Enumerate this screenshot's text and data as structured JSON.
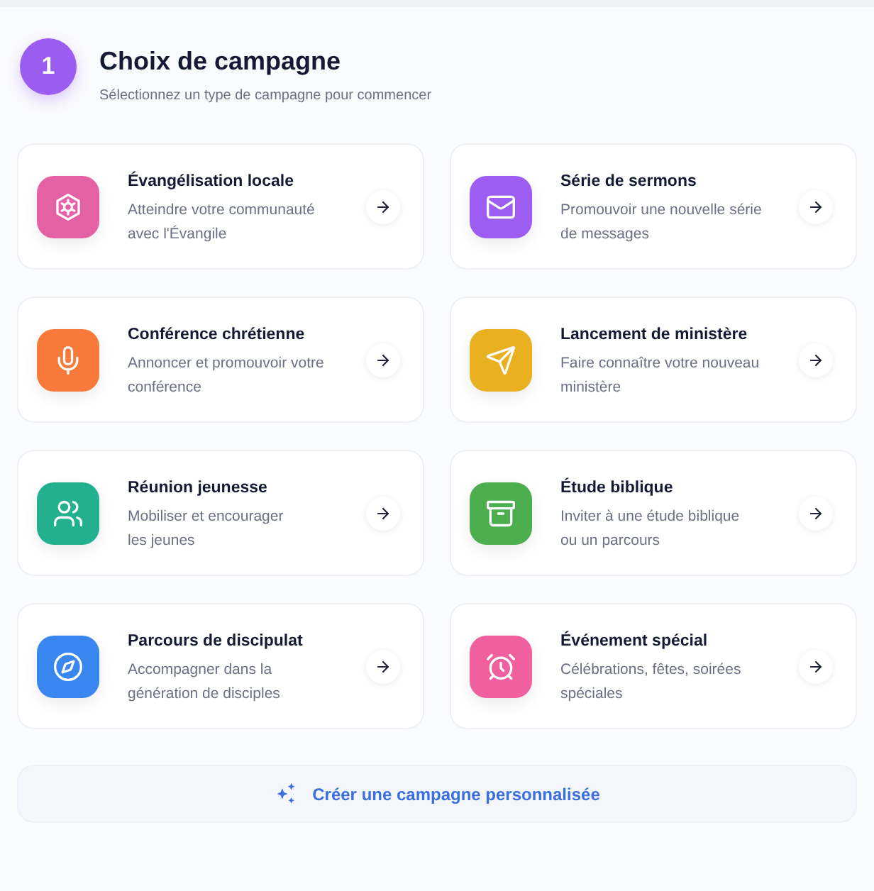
{
  "header": {
    "step": "1",
    "title": "Choix de campagne",
    "subtitle": "Sélectionnez un type de campagne pour commencer"
  },
  "campaign_types": [
    {
      "title": "Évangélisation locale",
      "description": "Atteindre votre communauté\navec l'Évangile",
      "color": "#e462a4"
    },
    {
      "title": "Série de sermons",
      "description": "Promouvoir une nouvelle série\nde messages",
      "color": "#9d5cf2"
    },
    {
      "title": "Conférence chrétienne",
      "description": "Annoncer et promouvoir votre\nconférence",
      "color": "#f8793a"
    },
    {
      "title": "Lancement de ministère",
      "description": "Faire connaître votre nouveau\nministère",
      "color": "#e9b020"
    },
    {
      "title": "Réunion jeunesse",
      "description": "Mobiliser et encourager\nles jeunes",
      "color": "#22b08f"
    },
    {
      "title": "Étude biblique",
      "description": "Inviter à une étude biblique\nou un parcours",
      "color": "#4cae4f"
    },
    {
      "title": "Parcours de discipulat",
      "description": "Accompagner dans la\ngénération de disciples",
      "color": "#3a86f0"
    },
    {
      "title": "Événement spécial",
      "description": "Célébrations, fêtes, soirées\nspéciales",
      "color": "#f0609e"
    }
  ],
  "custom_button": {
    "label": "Créer une campagne personnalisée"
  }
}
